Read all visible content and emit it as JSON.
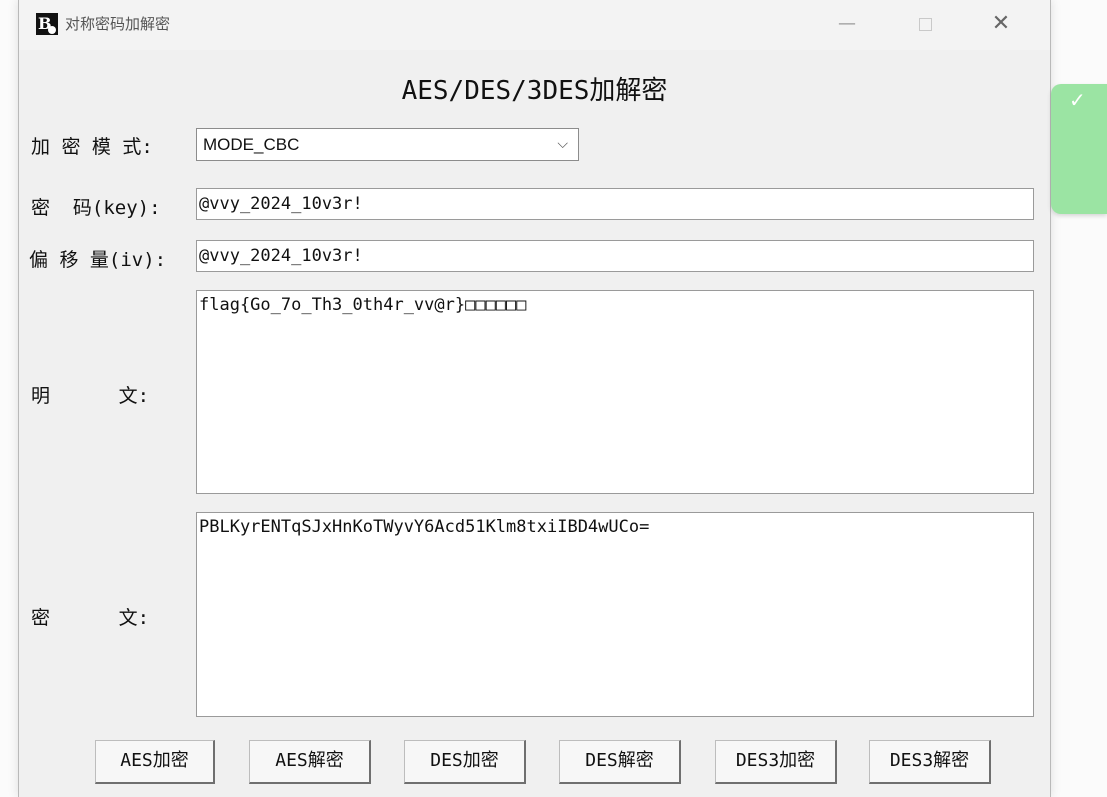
{
  "window": {
    "title": "对称密码加解密",
    "icon_glyph": "B",
    "controls": {
      "minimize": "—",
      "close": "✕"
    }
  },
  "heading": "AES/DES/3DES加解密",
  "form": {
    "mode_label": "加 密 模 式:",
    "mode_value": "MODE_CBC",
    "key_label": "密  码(key):",
    "key_value": "@vvy_2024_10v3r!",
    "iv_label": "偏 移 量(iv):",
    "iv_value": "@vvy_2024_10v3r!",
    "plaintext_label": "明      文:",
    "plaintext_value": "flag{Go_7o_Th3_0th4r_vv@r}□□□□□□",
    "ciphertext_label": "密      文:",
    "ciphertext_value": "PBLKyrENTqSJxHnKoTWyvY6Acd51Klm8txiIBD4wUCo="
  },
  "buttons": [
    "AES加密",
    "AES解密",
    "DES加密",
    "DES解密",
    "DES3加密",
    "DES3解密"
  ],
  "toast": {
    "icon": "check-icon",
    "color": "#9be4a3",
    "glyph": "✓"
  }
}
